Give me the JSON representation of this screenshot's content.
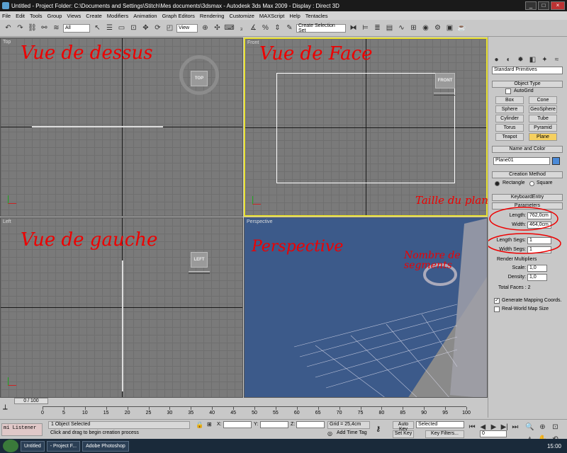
{
  "title": "Untitled    - Project Folder: C:\\Documents and Settings\\Stitch\\Mes documents\\3dsmax    - Autodesk 3ds Max  2009       - Display : Direct 3D",
  "menu": [
    "File",
    "Edit",
    "Tools",
    "Group",
    "Views",
    "Create",
    "Modifiers",
    "Animation",
    "Graph Editors",
    "Rendering",
    "Customize",
    "MAXScript",
    "Help",
    "Tentacles"
  ],
  "toolbar": {
    "filter": "All",
    "ref_coord": "View",
    "selection_set": "Create Selection Set"
  },
  "viewports": {
    "top": {
      "label": "Top",
      "annotation": "Vue de dessus",
      "cube": "TOP"
    },
    "front": {
      "label": "Front",
      "annotation": "Vue de Face",
      "cube": "FRONT"
    },
    "left": {
      "label": "Left",
      "annotation": "Vue de gauche",
      "cube": "LEFT"
    },
    "perspective": {
      "label": "Perspective",
      "annotation": "Perspective"
    }
  },
  "panel": {
    "category": "Standard Primitives",
    "object_type": "Object Type",
    "autogrid": "AutoGrid",
    "buttons": [
      "Box",
      "Cone",
      "Sphere",
      "GeoSphere",
      "Cylinder",
      "Tube",
      "Torus",
      "Pyramid",
      "Teapot",
      "Plane"
    ],
    "name_color": "Name and Color",
    "object_name": "Plane01",
    "creation_method": "Creation Method",
    "rectangle": "Rectangle",
    "square": "Square",
    "keyboard_entry": "KeyboardEntry",
    "parameters": "Parameters",
    "length_label": "Length:",
    "length_value": "762,0cm",
    "width_label": "Width:",
    "width_value": "464,0cm",
    "length_segs_label": "Length Segs:",
    "length_segs_value": "1",
    "width_segs_label": "Width Segs:",
    "width_segs_value": "1",
    "render_multipliers": "Render Multipliers",
    "scale_label": "Scale:",
    "scale_value": "1,0",
    "density_label": "Density:",
    "density_value": "1,0",
    "total_faces": "Total Faces : 2",
    "gen_mapping": "Generate Mapping Coords.",
    "real_world": "Real-World Map Size",
    "anno_size": "Taille du plan",
    "anno_segments": "Nombre de segments"
  },
  "timeline": {
    "frame": "0 / 100",
    "ticks": [
      "0",
      "5",
      "10",
      "15",
      "20",
      "25",
      "30",
      "35",
      "40",
      "45",
      "50",
      "55",
      "60",
      "65",
      "70",
      "75",
      "80",
      "85",
      "90",
      "95",
      "100"
    ]
  },
  "status": {
    "listener": "mi Listener",
    "selected": "1 Object Selected",
    "prompt": "Click and drag to begin creation process",
    "x_label": "X:",
    "y_label": "Y:",
    "z_label": "Z:",
    "grid": "Grid = 25,4cm",
    "add_time_tag": "Add Time Tag",
    "auto_key": "Auto Key",
    "set_key": "Set Key",
    "selected_dd": "Selected",
    "key_filters": "Key Filters...",
    "frame_field": "0"
  },
  "taskbar": {
    "items": [
      "Untitled",
      "- Project F...",
      "Adobe Photoshop"
    ],
    "clock": "15:00"
  }
}
